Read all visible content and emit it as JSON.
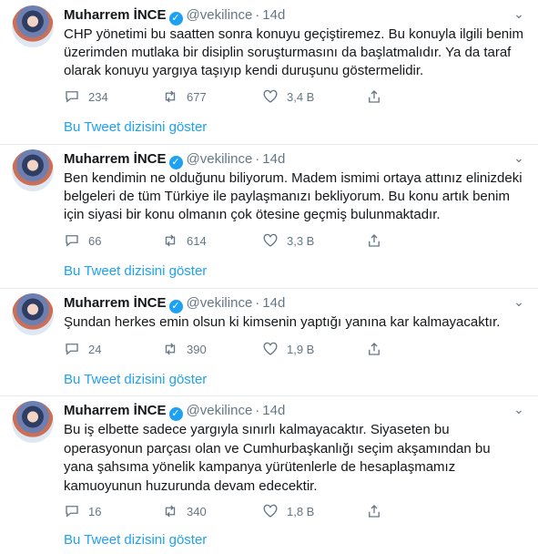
{
  "tweets": [
    {
      "author": {
        "name": "Muharrem İNCE",
        "verified": true,
        "handle": "@vekilince",
        "time": "14d"
      },
      "text": "CHP yönetimi bu saatten sonra konuyu geçiştiremez. Bu konuyla ilgili benim üzerimden mutlaka bir disiplin soruşturmasını da başlatmalıdır. Ya da  taraf olarak konuyu yargıya taşıyıp kendi duruşunu göstermelidir.",
      "replies": "234",
      "retweets": "677",
      "likes": "3,4 B",
      "thread_link": "Bu Tweet dizisini göster"
    },
    {
      "author": {
        "name": "Muharrem İNCE",
        "verified": true,
        "handle": "@vekilince",
        "time": "14d"
      },
      "text": "Ben kendimin ne olduğunu biliyorum. Madem ismimi ortaya attınız elinizdeki belgeleri de tüm Türkiye ile paylaşmanızı bekliyorum.  Bu konu artık benim için siyasi bir konu olmanın çok ötesine geçmiş bulunmaktadır.",
      "replies": "66",
      "retweets": "614",
      "likes": "3,3 B",
      "thread_link": "Bu Tweet dizisini göster"
    },
    {
      "author": {
        "name": "Muharrem İNCE",
        "verified": true,
        "handle": "@vekilince",
        "time": "14d"
      },
      "text": "Şundan herkes emin olsun ki kimsenin yaptığı yanına kar kalmayacaktır.",
      "replies": "24",
      "retweets": "390",
      "likes": "1,9 B",
      "thread_link": "Bu Tweet dizisini göster"
    },
    {
      "author": {
        "name": "Muharrem İNCE",
        "verified": true,
        "handle": "@vekilince",
        "time": "14d"
      },
      "text": "Bu iş elbette sadece yargıyla sınırlı kalmayacaktır. Siyaseten bu operasyonun parçası olan ve Cumhurbaşkanlığı seçim akşamından bu yana şahsıma yönelik kampanya yürütenlerle de hesaplaşmamız kamuoyunun huzurunda devam edecektir.",
      "replies": "16",
      "retweets": "340",
      "likes": "1,8 B",
      "thread_link": "Bu Tweet dizisini göster"
    }
  ],
  "icons": {
    "reply": "reply-icon",
    "retweet": "retweet-icon",
    "like": "heart-icon",
    "share": "share-icon",
    "more": "chevron-down-icon",
    "verified": "verified-badge-icon"
  },
  "colors": {
    "link": "#1da1f2",
    "verified": "#1da1f2",
    "secondary_text": "#657786",
    "divider": "#e6ecf0"
  }
}
